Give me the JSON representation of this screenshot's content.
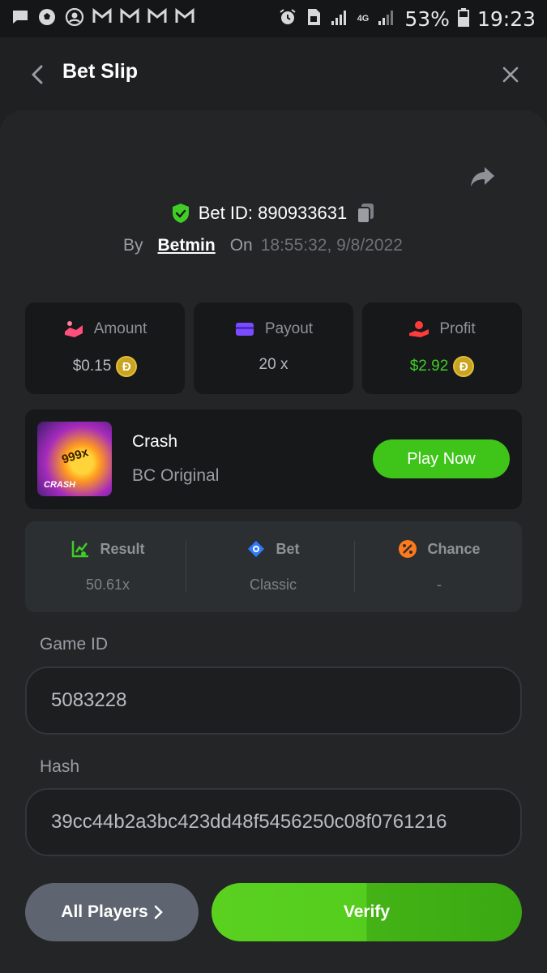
{
  "status_bar": {
    "battery": "53%",
    "time": "19:23",
    "network": "4G"
  },
  "header": {
    "title": "Bet Slip"
  },
  "bet": {
    "id_label": "Bet ID: 890933631",
    "by_label": "By",
    "user": "Betmin",
    "on_label": "On",
    "time": "18:55:32, 9/8/2022"
  },
  "stats": [
    {
      "label": "Amount",
      "value": "$0.15",
      "coin": "Đ",
      "color": "#ff4f7b"
    },
    {
      "label": "Payout",
      "value": "20 x",
      "coin": "",
      "color": "#7b4cff"
    },
    {
      "label": "Profit",
      "value": "$2.92",
      "coin": "Đ",
      "color": "#ff3b3b"
    }
  ],
  "game": {
    "name": "Crash",
    "provider": "BC Original",
    "thumb_multiplier": "999x",
    "thumb_title": "CRASH",
    "play_label": "Play Now"
  },
  "result": {
    "columns": [
      {
        "label": "Result",
        "value": "50.61x"
      },
      {
        "label": "Bet",
        "value": "Classic"
      },
      {
        "label": "Chance",
        "value": "-"
      }
    ]
  },
  "fields": {
    "game_id_label": "Game ID",
    "game_id_value": "5083228",
    "hash_label": "Hash",
    "hash_value": "39cc44b2a3bc423dd48f5456250c08f0761216"
  },
  "buttons": {
    "all_players": "All Players",
    "verify": "Verify"
  },
  "colors": {
    "accent_green": "#3fc419",
    "profit_green": "#3fcd26",
    "background": "#1e2022"
  }
}
